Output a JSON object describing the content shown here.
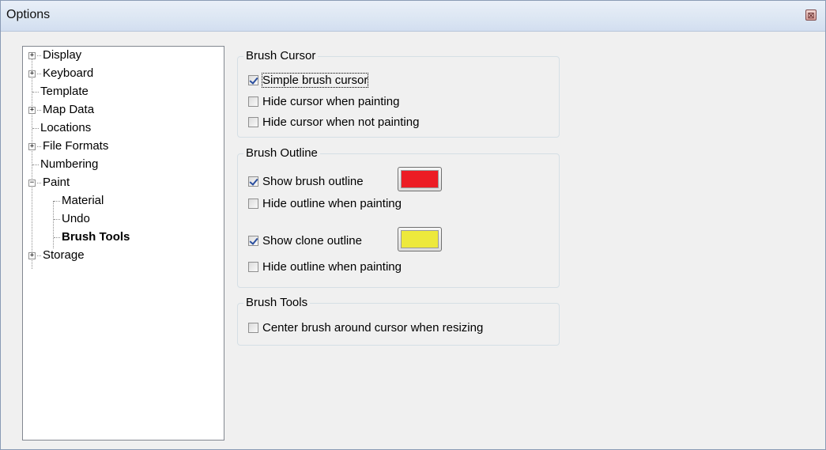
{
  "window": {
    "title": "Options",
    "close_glyph": "⊠"
  },
  "tree": {
    "items": [
      {
        "label": "Display",
        "expander": "+"
      },
      {
        "label": "Keyboard",
        "expander": "+"
      },
      {
        "label": "Template",
        "expander": ""
      },
      {
        "label": "Map Data",
        "expander": "+"
      },
      {
        "label": "Locations",
        "expander": ""
      },
      {
        "label": "File Formats",
        "expander": "+"
      },
      {
        "label": "Numbering",
        "expander": ""
      },
      {
        "label": "Paint",
        "expander": "−"
      },
      {
        "label": "Material",
        "expander": ""
      },
      {
        "label": "Undo",
        "expander": ""
      },
      {
        "label": "Brush Tools",
        "expander": "",
        "selected": true
      },
      {
        "label": "Storage",
        "expander": "+"
      }
    ]
  },
  "brush_cursor": {
    "title": "Brush Cursor",
    "simple_brush_cursor": {
      "label": "Simple brush cursor",
      "checked": true
    },
    "hide_when_painting": {
      "label": "Hide cursor when painting",
      "checked": false
    },
    "hide_when_not_painting": {
      "label": "Hide cursor when not painting",
      "checked": false
    }
  },
  "brush_outline": {
    "title": "Brush Outline",
    "show_brush_outline": {
      "label": "Show brush outline",
      "checked": true,
      "color": "#ec1c24"
    },
    "hide_brush_outline_painting": {
      "label": "Hide outline when painting",
      "checked": false
    },
    "show_clone_outline": {
      "label": "Show clone outline",
      "checked": true,
      "color": "#ede93c"
    },
    "hide_clone_outline_painting": {
      "label": "Hide outline when painting",
      "checked": false
    }
  },
  "brush_tools": {
    "title": "Brush Tools",
    "center_brush": {
      "label": "Center brush around cursor when resizing",
      "checked": false
    }
  }
}
